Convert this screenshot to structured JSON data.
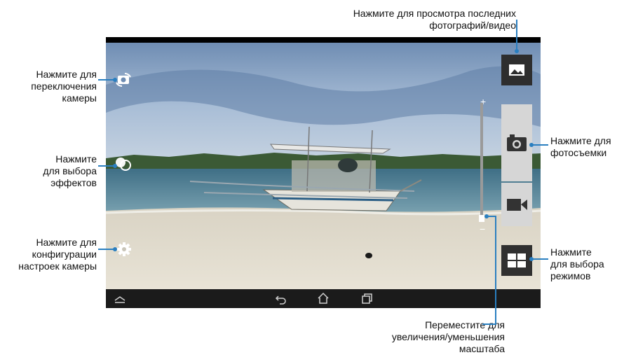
{
  "callouts": {
    "recent": [
      "Нажмите для просмотра последних",
      "фотографий/видео"
    ],
    "switch_camera": [
      "Нажмите для",
      "переключения",
      "камеры"
    ],
    "effects": [
      "Нажмите",
      "для выбора",
      "эффектов"
    ],
    "settings": [
      "Нажмите для",
      "конфигурации",
      "настроек камеры"
    ],
    "shutter": [
      "Нажмите для",
      "фотосъемки"
    ],
    "modes": [
      "Нажмите",
      "для выбора",
      "режимов"
    ],
    "zoom": [
      "Переместите для",
      "увеличения/уменьшения",
      "масштаба"
    ]
  },
  "zoom": {
    "plus": "+",
    "minus": "−",
    "level": 0
  },
  "icons": {
    "gallery": "gallery-icon",
    "switch": "camera-switch-icon",
    "effects": "effects-icon",
    "settings": "gear-icon",
    "shutter": "camera-icon",
    "video": "video-camera-icon",
    "modes": "modes-grid-icon",
    "nav": [
      "collapse-icon",
      "back-icon",
      "home-icon",
      "recent-apps-icon"
    ]
  },
  "colors": {
    "accent": "#2a7fc0",
    "button_bg": "#d6d6d6",
    "dark_button": "#303030"
  }
}
